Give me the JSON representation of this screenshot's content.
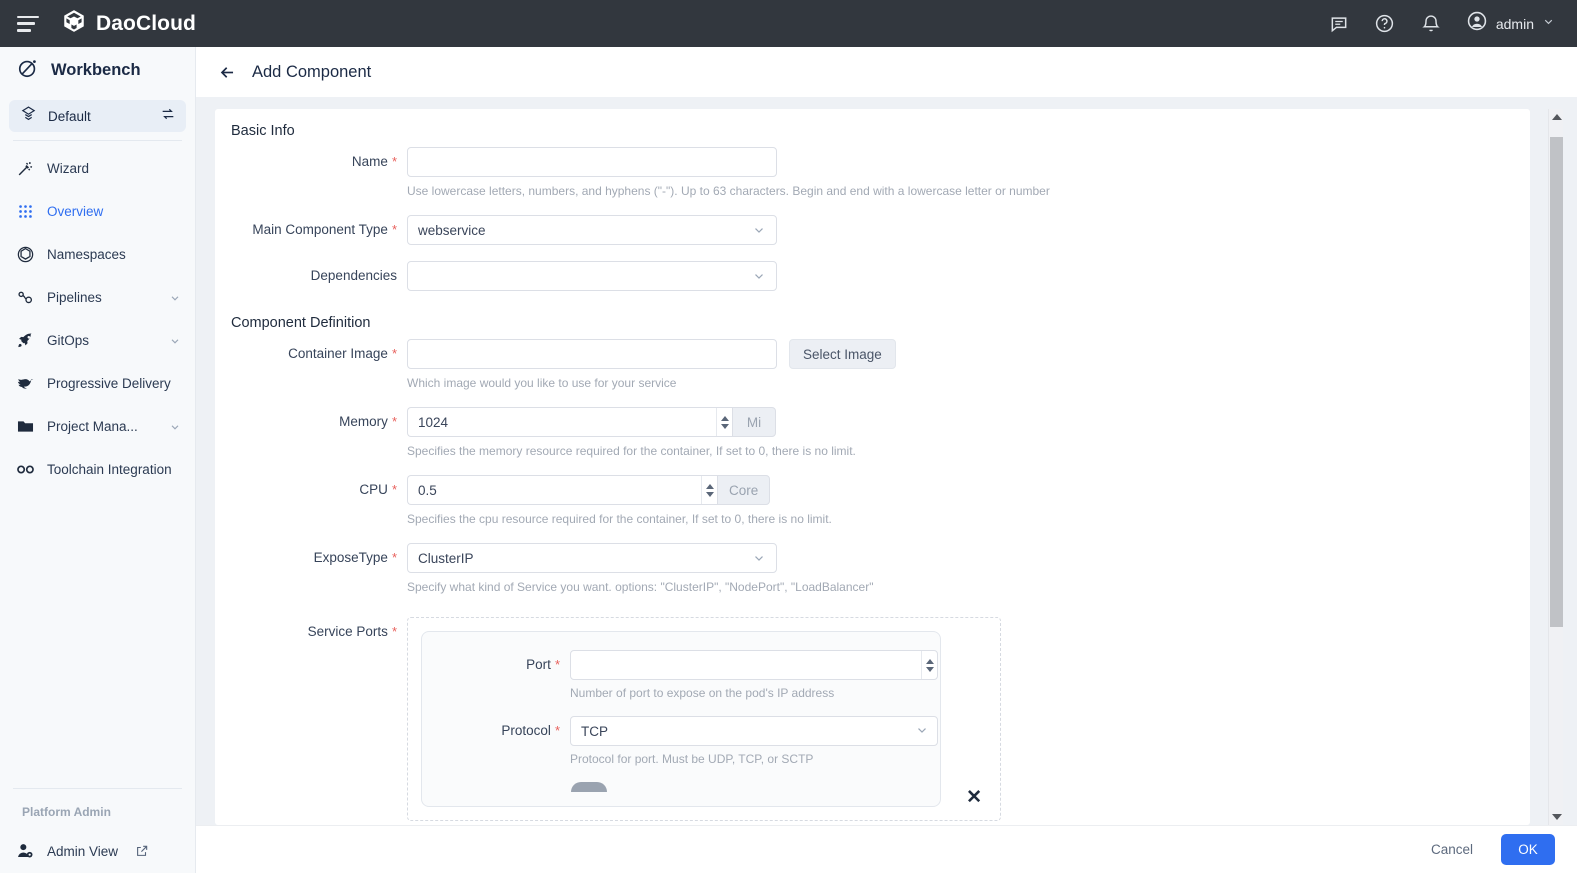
{
  "topbar": {
    "brand": "DaoCloud",
    "menu_icon": "hamburger-icon",
    "icons": [
      "feedback-icon",
      "help-icon",
      "notification-icon"
    ],
    "user": "admin",
    "background": "#32373e"
  },
  "sidebar": {
    "workbench_title": "Workbench",
    "workspace": {
      "label": "Default",
      "switch_icon": "switch-workspace-icon"
    },
    "items": [
      {
        "label": "Wizard",
        "icon": "wand-icon",
        "active": false,
        "expandable": false
      },
      {
        "label": "Overview",
        "icon": "grid-icon",
        "active": true,
        "expandable": false
      },
      {
        "label": "Namespaces",
        "icon": "cube-icon",
        "active": false,
        "expandable": false
      },
      {
        "label": "Pipelines",
        "icon": "pipeline-icon",
        "active": false,
        "expandable": true
      },
      {
        "label": "GitOps",
        "icon": "rocket-icon",
        "active": false,
        "expandable": true
      },
      {
        "label": "Progressive Delivery",
        "icon": "bird-icon",
        "active": false,
        "expandable": false
      },
      {
        "label": "Project Mana...",
        "icon": "folder-icon",
        "active": false,
        "expandable": true
      },
      {
        "label": "Toolchain Integration",
        "icon": "infinity-icon",
        "active": false,
        "expandable": false
      }
    ],
    "bottom": {
      "group_title": "Platform Admin",
      "admin_view": "Admin View",
      "external_icon": "external-link-icon"
    },
    "accent": "#2f6ef0"
  },
  "page": {
    "back_icon": "arrow-left-icon",
    "title": "Add Component"
  },
  "form": {
    "sections": {
      "basic_info": "Basic Info",
      "component_definition": "Component Definition"
    },
    "name": {
      "label": "Name",
      "required": true,
      "value": "",
      "placeholder": "",
      "hint": "Use lowercase letters, numbers, and hyphens (\"-\"). Up to 63 characters. Begin and end with a lowercase letter or number"
    },
    "main_component_type": {
      "label": "Main Component Type",
      "required": true,
      "value": "webservice",
      "chevron_icon": "chevron-down-icon"
    },
    "dependencies": {
      "label": "Dependencies",
      "required": false,
      "value": "",
      "chevron_icon": "chevron-down-icon"
    },
    "container_image": {
      "label": "Container Image",
      "required": true,
      "value": "",
      "button": "Select Image",
      "hint": "Which image would you like to use for your service"
    },
    "memory": {
      "label": "Memory",
      "required": true,
      "value": "1024",
      "unit": "Mi",
      "hint": "Specifies the memory resource required for the container, If set to 0, there is no limit."
    },
    "cpu": {
      "label": "CPU",
      "required": true,
      "value": "0.5",
      "unit": "Core",
      "hint": "Specifies the cpu resource required for the container, If set to 0, there is no limit."
    },
    "expose_type": {
      "label": "ExposeType",
      "required": true,
      "value": "ClusterIP",
      "hint": "Specify what kind of Service you want. options: \"ClusterIP\", \"NodePort\", \"LoadBalancer\"",
      "chevron_icon": "chevron-down-icon"
    },
    "service_ports": {
      "label": "Service Ports",
      "required": true,
      "port": {
        "label": "Port",
        "required": true,
        "value": "",
        "hint": "Number of port to expose on the pod's IP address"
      },
      "protocol": {
        "label": "Protocol",
        "required": true,
        "value": "TCP",
        "hint": "Protocol for port. Must be UDP, TCP, or SCTP",
        "chevron_icon": "chevron-down-icon"
      },
      "remove_icon": "close-icon"
    }
  },
  "footer": {
    "cancel": "Cancel",
    "ok": "OK",
    "ok_color": "#2f6ef0"
  },
  "scrollbar": {
    "up_icon": "scroll-up-arrow",
    "down_icon": "scroll-down-arrow"
  }
}
